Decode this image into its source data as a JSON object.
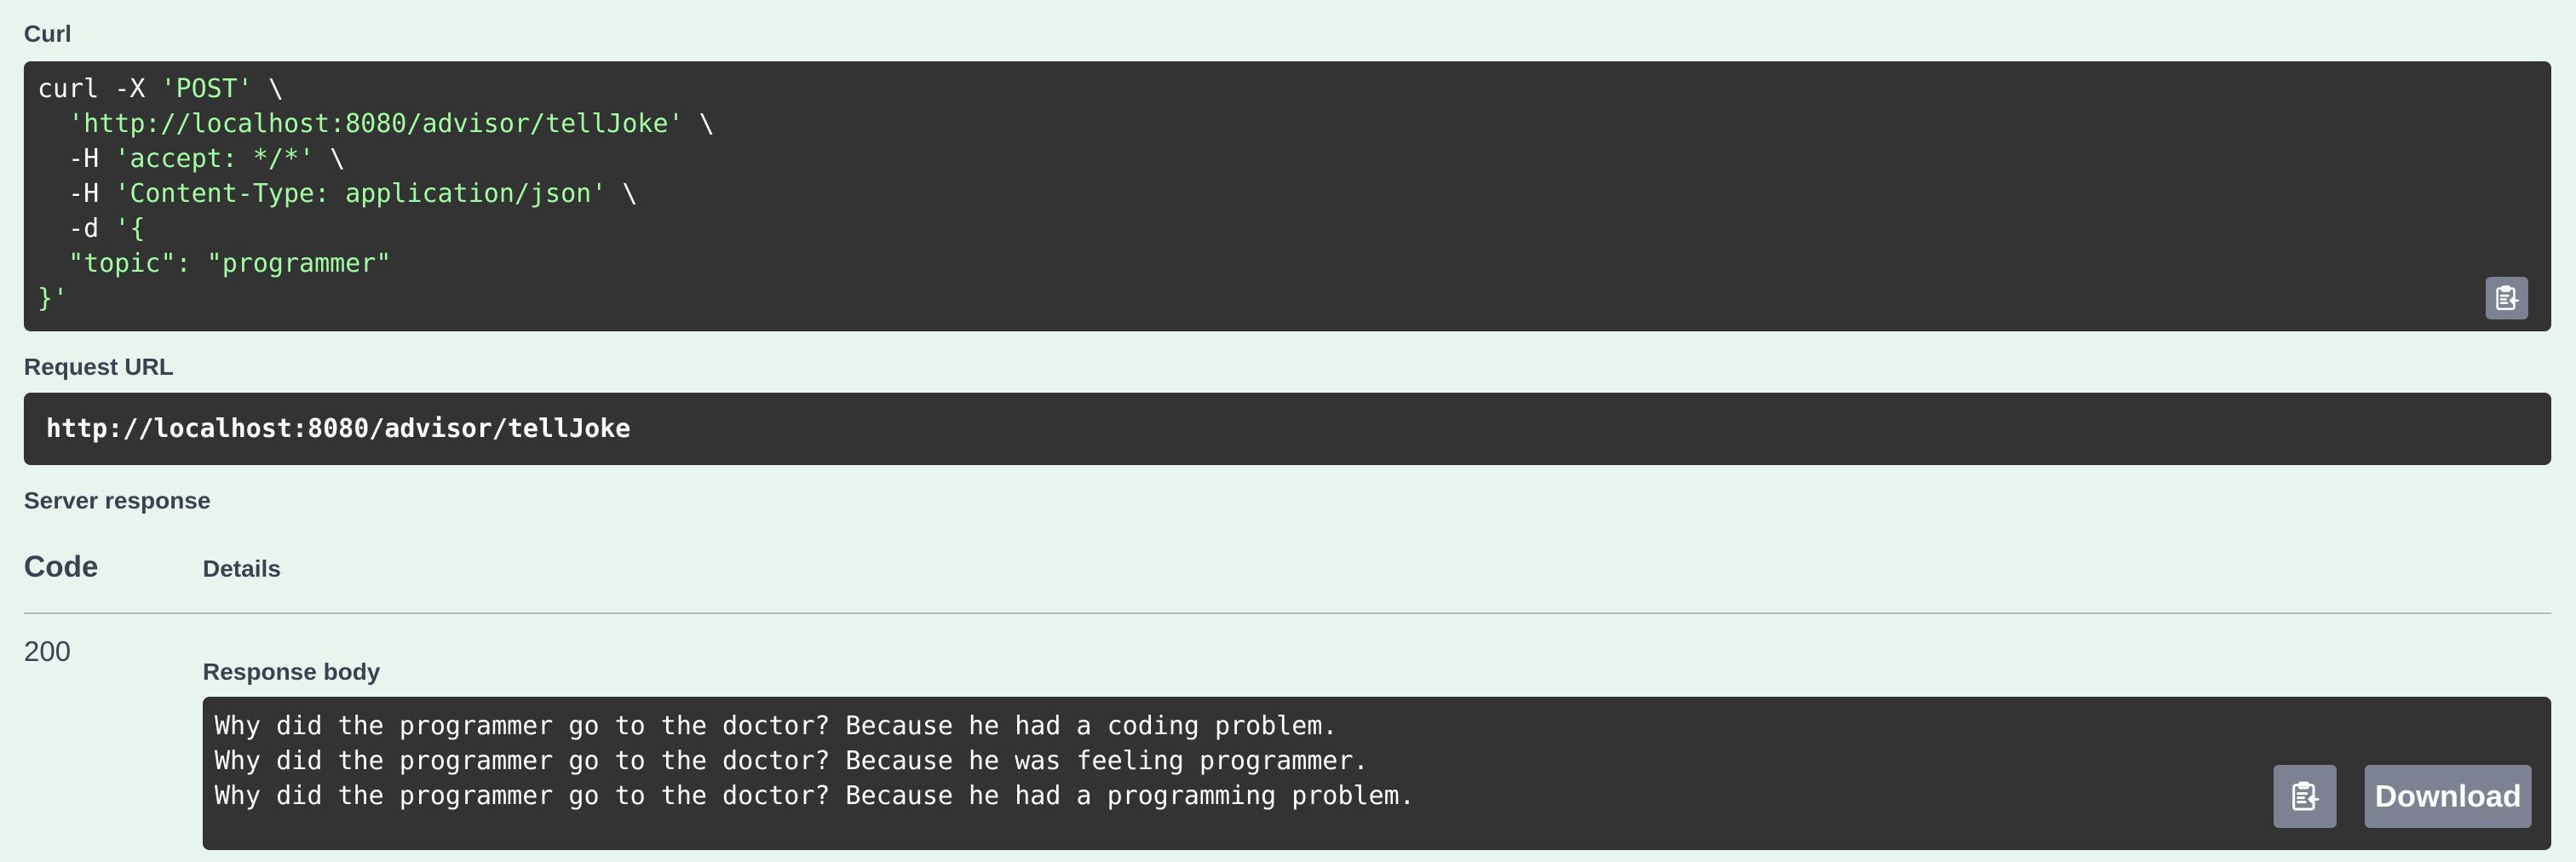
{
  "curl": {
    "label": "Curl",
    "lines": [
      [
        {
          "t": "curl -X ",
          "c": "plain"
        },
        {
          "t": "'POST'",
          "c": "str"
        },
        {
          "t": " \\",
          "c": "plain"
        }
      ],
      [
        {
          "t": "  ",
          "c": "plain"
        },
        {
          "t": "'http://localhost:8080/advisor/tellJoke'",
          "c": "str"
        },
        {
          "t": " \\",
          "c": "plain"
        }
      ],
      [
        {
          "t": "  -H ",
          "c": "plain"
        },
        {
          "t": "'accept: */*'",
          "c": "str"
        },
        {
          "t": " \\",
          "c": "plain"
        }
      ],
      [
        {
          "t": "  -H ",
          "c": "plain"
        },
        {
          "t": "'Content-Type: application/json'",
          "c": "str"
        },
        {
          "t": " \\",
          "c": "plain"
        }
      ],
      [
        {
          "t": "  -d ",
          "c": "plain"
        },
        {
          "t": "'{",
          "c": "str"
        }
      ],
      [
        {
          "t": "  \"topic\": \"programmer\"",
          "c": "str"
        }
      ],
      [
        {
          "t": "}'",
          "c": "str"
        }
      ]
    ],
    "copy_icon": "clipboard-icon"
  },
  "request_url": {
    "label": "Request URL",
    "value": "http://localhost:8080/advisor/tellJoke"
  },
  "server_response": {
    "label": "Server response",
    "code_header": "Code",
    "details_header": "Details",
    "code": "200",
    "body_label": "Response body",
    "body_lines": [
      "Why did the programmer go to the doctor? Because he had a coding problem.",
      "Why did the programmer go to the doctor? Because he was feeling programmer.",
      "Why did the programmer go to the doctor? Because he had a programming problem."
    ],
    "copy_icon": "clipboard-icon",
    "download_label": "Download"
  },
  "colors": {
    "background": "#e8f4ee",
    "code_bg": "#333333",
    "string": "#a2fca2",
    "button": "#7d8293",
    "text": "#3b4151"
  }
}
